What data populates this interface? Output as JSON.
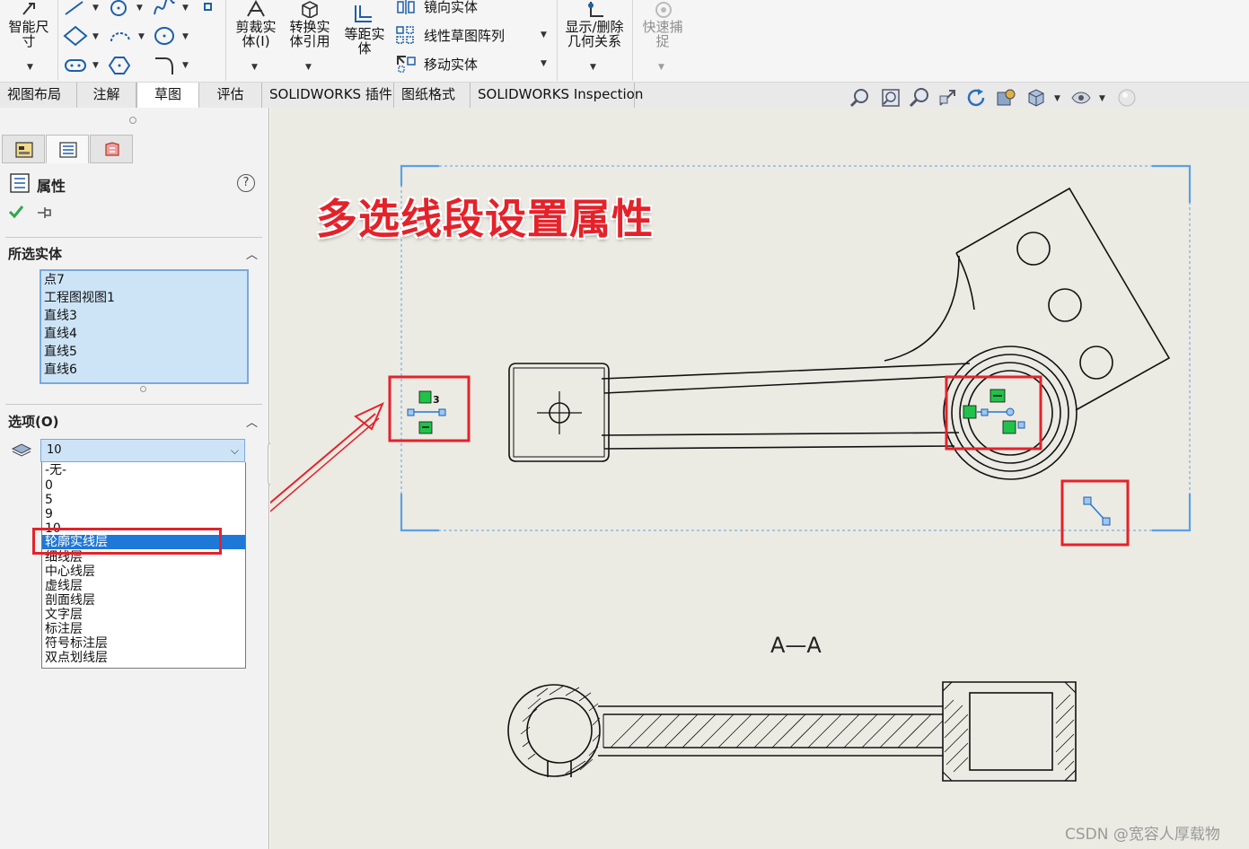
{
  "ribbon": {
    "smart_dimension": "智能尺\n寸",
    "trim_entities": "剪裁实\n体(I)",
    "convert_entities": "转换实\n体引用",
    "offset_entities": "等距实\n体",
    "mirror_entities": "镜向实体",
    "linear_pattern": "线性草图阵列",
    "move_entities": "移动实体",
    "display_delete_relations": "显示/删除\n几何关系",
    "quick_snaps": "快速捕\n捉"
  },
  "tabs": [
    {
      "label": "视图布局"
    },
    {
      "label": "注解"
    },
    {
      "label": "草图"
    },
    {
      "label": "评估"
    },
    {
      "label": "SOLIDWORKS 插件"
    },
    {
      "label": "图纸格式"
    },
    {
      "label": "SOLIDWORKS Inspection"
    }
  ],
  "panel": {
    "title": "属性",
    "selected_section": "所选实体",
    "selected_items": [
      "点7",
      "工程图视图1",
      "直线3",
      "直线4",
      "直线5",
      "直线6"
    ],
    "options_section": "选项(O)",
    "layer_value": "10",
    "layer_options": [
      "-无-",
      "0",
      "5",
      "9",
      "10",
      "轮廓实线层",
      "细线层",
      "中心线层",
      "虚线层",
      "剖面线层",
      "文字层",
      "标注层",
      "符号标注层",
      "双点划线层"
    ]
  },
  "drawing": {
    "banner": "多选线段设置属性",
    "section_label": "A—A",
    "badge": "3"
  },
  "watermark": "CSDN @宽容人厚载物",
  "colors": {
    "accent": "#e4222a",
    "selection_blue": "#1e78d7",
    "list_bg": "#cde4f7",
    "canvas_bg": "#ebebe4",
    "point_green": "#21c24a",
    "view_boundary": "#5aa0e6"
  },
  "icons": [
    "smart-dimension-icon",
    "line-icon",
    "circle-icon",
    "spline-icon",
    "rectangle-icon",
    "polygon-icon",
    "trim-icon",
    "convert-icon",
    "offset-icon",
    "mirror-icon",
    "pattern-icon",
    "move-icon",
    "relations-icon",
    "snap-icon",
    "zoom-fit-icon",
    "zoom-area-icon",
    "zoom-icon",
    "pan-icon",
    "rotate-icon",
    "display-style-icon",
    "view-orientation-icon",
    "hide-show-icon",
    "appearance-icon",
    "help-icon",
    "ok-icon",
    "pin-icon",
    "layer-icon"
  ]
}
